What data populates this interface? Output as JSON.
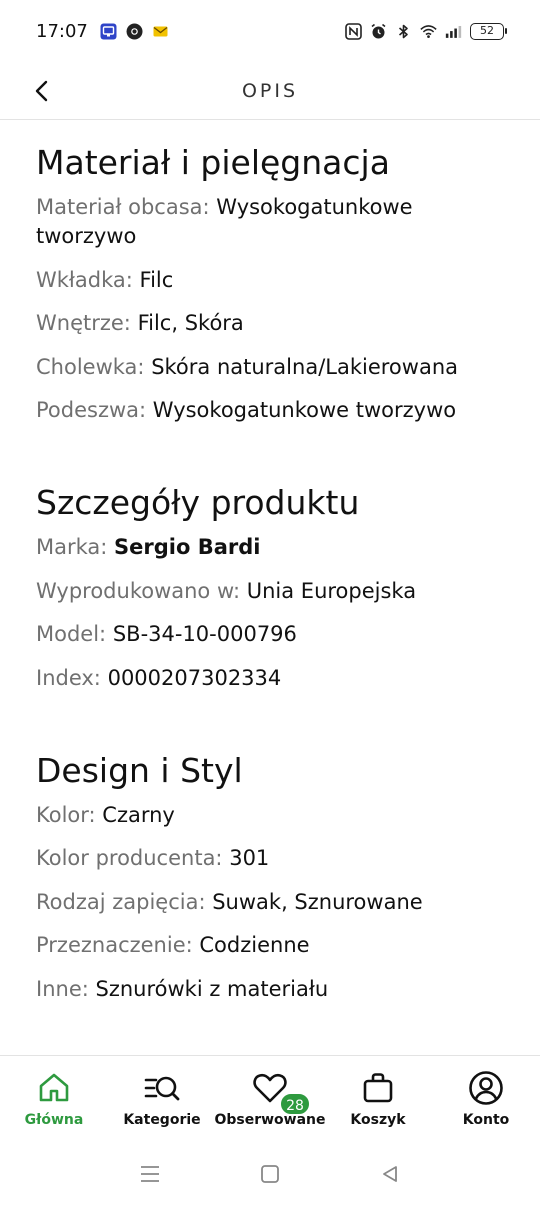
{
  "status": {
    "time": "17:07",
    "battery": "52",
    "left_icons": [
      "app-icon",
      "chrome-icon",
      "mail-icon"
    ],
    "right_icons": [
      "nfc-icon",
      "alarm-icon",
      "bluetooth-icon",
      "wifi-icon",
      "signal-icon"
    ]
  },
  "header": {
    "title": "OPIS"
  },
  "sections": {
    "material": {
      "title": "Materiał i pielęgnacja",
      "rows": [
        {
          "label": "Materiał obcasa:",
          "value": "Wysokogatunkowe tworzywo"
        },
        {
          "label": "Wkładka:",
          "value": "Filc"
        },
        {
          "label": "Wnętrze:",
          "value": "Filc, Skóra"
        },
        {
          "label": "Cholewka:",
          "value": "Skóra naturalna/Lakierowana"
        },
        {
          "label": "Podeszwa:",
          "value": "Wysokogatunkowe tworzywo"
        }
      ]
    },
    "details": {
      "title": "Szczegóły produktu",
      "rows": [
        {
          "label": "Marka:",
          "value": "Sergio Bardi"
        },
        {
          "label": "Wyprodukowano w:",
          "value": "Unia Europejska"
        },
        {
          "label": "Model:",
          "value": "SB-34-10-000796"
        },
        {
          "label": "Index:",
          "value": "0000207302334"
        }
      ]
    },
    "design": {
      "title": "Design i Styl",
      "rows": [
        {
          "label": "Kolor:",
          "value": "Czarny"
        },
        {
          "label": "Kolor producenta:",
          "value": "301"
        },
        {
          "label": "Rodzaj zapięcia:",
          "value": "Suwak, Sznurowane"
        },
        {
          "label": "Przeznaczenie:",
          "value": "Codzienne"
        },
        {
          "label": "Inne:",
          "value": "Sznurówki z materiału"
        }
      ]
    }
  },
  "nav": {
    "items": [
      {
        "label": "Główna",
        "icon": "home-icon"
      },
      {
        "label": "Kategorie",
        "icon": "category-search-icon"
      },
      {
        "label": "Obserwowane",
        "icon": "heart-icon",
        "badge": "28"
      },
      {
        "label": "Koszyk",
        "icon": "bag-icon"
      },
      {
        "label": "Konto",
        "icon": "user-icon"
      }
    ],
    "active_color": "#2e9a3f"
  }
}
